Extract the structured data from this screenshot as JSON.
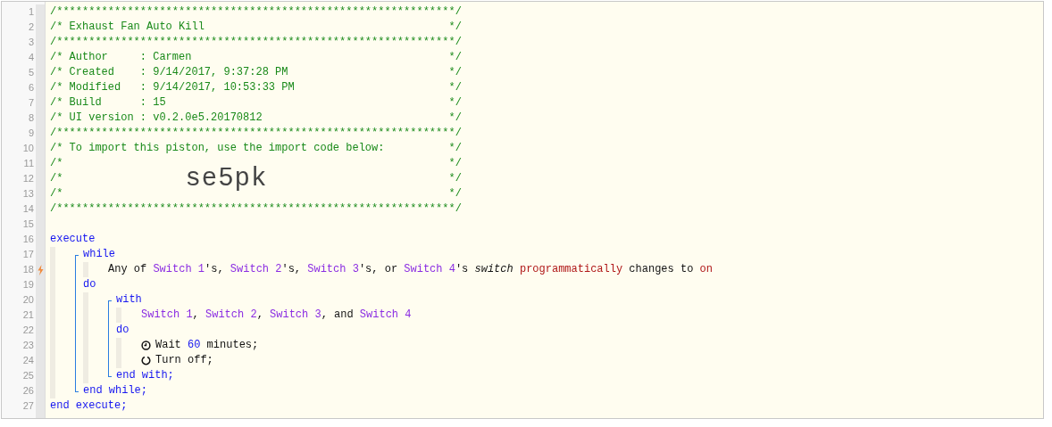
{
  "editor": {
    "line_numbers": [
      {
        "number": "1",
        "trigger": false
      },
      {
        "number": "2",
        "trigger": false
      },
      {
        "number": "3",
        "trigger": false
      },
      {
        "number": "4",
        "trigger": false
      },
      {
        "number": "5",
        "trigger": false
      },
      {
        "number": "6",
        "trigger": false
      },
      {
        "number": "7",
        "trigger": false
      },
      {
        "number": "8",
        "trigger": false
      },
      {
        "number": "9",
        "trigger": false
      },
      {
        "number": "10",
        "trigger": false
      },
      {
        "number": "11",
        "trigger": false
      },
      {
        "number": "12",
        "trigger": false
      },
      {
        "number": "13",
        "trigger": false
      },
      {
        "number": "14",
        "trigger": false
      },
      {
        "number": "15",
        "trigger": false
      },
      {
        "number": "16",
        "trigger": false
      },
      {
        "number": "17",
        "trigger": false
      },
      {
        "number": "18",
        "trigger": true
      },
      {
        "number": "19",
        "trigger": false
      },
      {
        "number": "20",
        "trigger": false
      },
      {
        "number": "21",
        "trigger": false
      },
      {
        "number": "22",
        "trigger": false
      },
      {
        "number": "23",
        "trigger": false
      },
      {
        "number": "24",
        "trigger": false
      },
      {
        "number": "25",
        "trigger": false
      },
      {
        "number": "26",
        "trigger": false
      },
      {
        "number": "27",
        "trigger": false
      }
    ],
    "header": [
      {
        "kind": "rule",
        "text": "/**************************************************************/"
      },
      {
        "kind": "comment",
        "text": "/* Exhaust Fan Auto Kill",
        "end": "*/"
      },
      {
        "kind": "rule",
        "text": "/**************************************************************/"
      },
      {
        "kind": "comment",
        "text": "/* Author     : Carmen",
        "end": "*/"
      },
      {
        "kind": "comment",
        "text": "/* Created    : 9/14/2017, 9:37:28 PM",
        "end": "*/"
      },
      {
        "kind": "comment",
        "text": "/* Modified   : 9/14/2017, 10:53:33 PM",
        "end": "*/"
      },
      {
        "kind": "comment",
        "text": "/* Build      : 15",
        "end": "*/"
      },
      {
        "kind": "comment",
        "text": "/* UI version : v0.2.0e5.20170812",
        "end": "*/"
      },
      {
        "kind": "rule",
        "text": "/**************************************************************/"
      },
      {
        "kind": "comment",
        "text": "/* To import this piston, use the import code below:",
        "end": "*/"
      },
      {
        "kind": "comment",
        "text": "/*",
        "end": "*/"
      },
      {
        "kind": "import_code",
        "text": "/*",
        "code": "se5pk",
        "end": "*/"
      },
      {
        "kind": "comment",
        "text": "/*",
        "end": "*/"
      },
      {
        "kind": "rule",
        "text": "/**************************************************************/"
      }
    ],
    "program": {
      "kind": "block",
      "sections": [
        {
          "head": [
            {
              "kind": "keyword",
              "text": "execute"
            }
          ],
          "children": [
            {
              "kind": "block",
              "sections": [
                {
                  "head": [
                    {
                      "kind": "keyword",
                      "text": "while"
                    }
                  ],
                  "children": [
                    {
                      "kind": "condition",
                      "segments": [
                        {
                          "kind": "plain",
                          "text": "Any of "
                        },
                        {
                          "kind": "device",
                          "text": "Switch 1"
                        },
                        {
                          "kind": "plain",
                          "text": "'s, "
                        },
                        {
                          "kind": "device",
                          "text": "Switch 2"
                        },
                        {
                          "kind": "plain",
                          "text": "'s, "
                        },
                        {
                          "kind": "device",
                          "text": "Switch 3"
                        },
                        {
                          "kind": "plain",
                          "text": "'s, or "
                        },
                        {
                          "kind": "device",
                          "text": "Switch 4"
                        },
                        {
                          "kind": "plain",
                          "text": "'s "
                        },
                        {
                          "kind": "attribute",
                          "text": "switch"
                        },
                        {
                          "kind": "operator",
                          "text": " programmatically"
                        },
                        {
                          "kind": "plain",
                          "text": " changes to "
                        },
                        {
                          "kind": "operator",
                          "text": "on"
                        }
                      ]
                    }
                  ]
                },
                {
                  "head": [
                    {
                      "kind": "keyword",
                      "text": "do"
                    }
                  ],
                  "children": [
                    {
                      "kind": "block",
                      "sections": [
                        {
                          "head": [
                            {
                              "kind": "keyword",
                              "text": "with"
                            }
                          ],
                          "children": [
                            {
                              "kind": "devices",
                              "segments": [
                                {
                                  "kind": "device",
                                  "text": "Switch 1"
                                },
                                {
                                  "kind": "plain",
                                  "text": ", "
                                },
                                {
                                  "kind": "device",
                                  "text": "Switch 2"
                                },
                                {
                                  "kind": "plain",
                                  "text": ", "
                                },
                                {
                                  "kind": "device",
                                  "text": "Switch 3"
                                },
                                {
                                  "kind": "plain",
                                  "text": ", and "
                                },
                                {
                                  "kind": "device",
                                  "text": "Switch 4"
                                }
                              ]
                            }
                          ]
                        },
                        {
                          "head": [
                            {
                              "kind": "keyword",
                              "text": "do"
                            }
                          ],
                          "children": [
                            {
                              "kind": "wait",
                              "segments": [
                                {
                                  "kind": "plain",
                                  "text": "Wait "
                                },
                                {
                                  "kind": "number",
                                  "text": "60"
                                },
                                {
                                  "kind": "plain",
                                  "text": " minutes;"
                                }
                              ]
                            },
                            {
                              "kind": "command",
                              "segments": [
                                {
                                  "kind": "plain",
                                  "text": "Turn off;"
                                }
                              ]
                            }
                          ]
                        }
                      ],
                      "close": [
                        {
                          "kind": "keyword",
                          "text": "end with;"
                        }
                      ]
                    }
                  ]
                }
              ],
              "close": [
                {
                  "kind": "keyword",
                  "text": "end while;"
                }
              ]
            }
          ]
        }
      ],
      "close": [
        {
          "kind": "keyword",
          "text": "end execute;"
        }
      ]
    }
  }
}
